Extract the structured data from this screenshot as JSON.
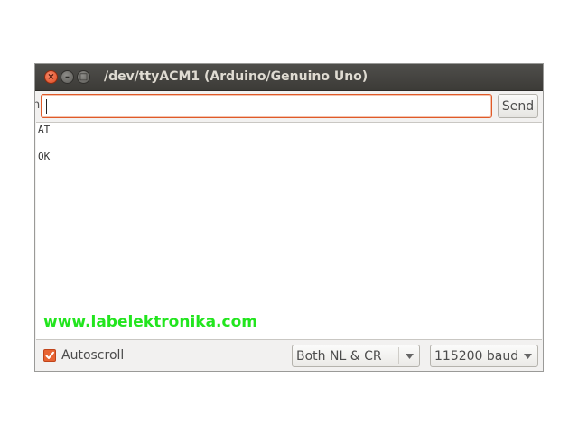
{
  "window": {
    "title": "/dev/ttyACM1 (Arduino/Genuino Uno)"
  },
  "toolbar": {
    "input_value": "",
    "send_label": "Send",
    "left_clip_text": "n"
  },
  "output": {
    "lines": [
      "AT",
      "OK"
    ]
  },
  "watermark": {
    "text": "www.labelektronika.com"
  },
  "statusbar": {
    "autoscroll_label": "Autoscroll",
    "autoscroll_checked": true,
    "line_ending": "Both NL & CR",
    "baud_rate": "115200 baud"
  },
  "colors": {
    "accent": "#e76433",
    "watermark": "#22e51e",
    "titlebar": "#3c3b37"
  }
}
